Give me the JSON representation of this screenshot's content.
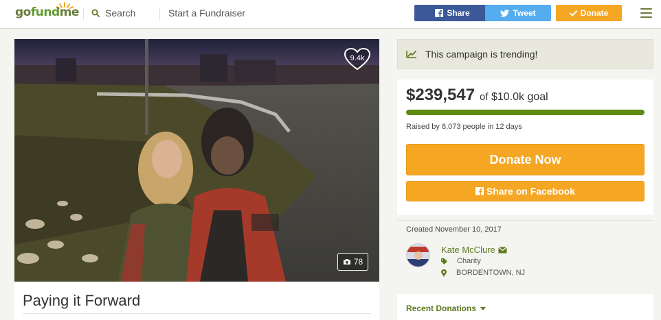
{
  "header": {
    "logo": {
      "pre": "go",
      "mid": "fund",
      "post": "me"
    },
    "search_label": "Search",
    "start_label": "Start a Fundraiser",
    "share_label": "Share",
    "tweet_label": "Tweet",
    "donate_label": "Donate",
    "icons": [
      "search-icon",
      "facebook-icon",
      "twitter-icon",
      "check-icon",
      "menu-icon"
    ]
  },
  "photo": {
    "hearts": "9.4k",
    "photo_count": "78"
  },
  "campaign": {
    "title": "Paying it Forward"
  },
  "trending": {
    "text": "This campaign is trending!",
    "icon": "trending-icon"
  },
  "goal": {
    "raised": "$239,547",
    "goal_text": "$10.0k goal",
    "of": "of",
    "raised_by": "Raised by 8,073 people in 12 days",
    "progress_fraction": 1.0,
    "donate_now": "Donate Now",
    "share_facebook": "Share on Facebook"
  },
  "organizer": {
    "created": "Created November 10, 2017",
    "name": "Kate McClure",
    "category": "Charity",
    "location": "BORDENTOWN, NJ"
  },
  "recent": {
    "label": "Recent Donations"
  },
  "colors": {
    "brand_green": "#5f8a12",
    "donate_orange": "#f5a623",
    "facebook_blue": "#3b5998",
    "twitter_blue": "#55acee"
  }
}
